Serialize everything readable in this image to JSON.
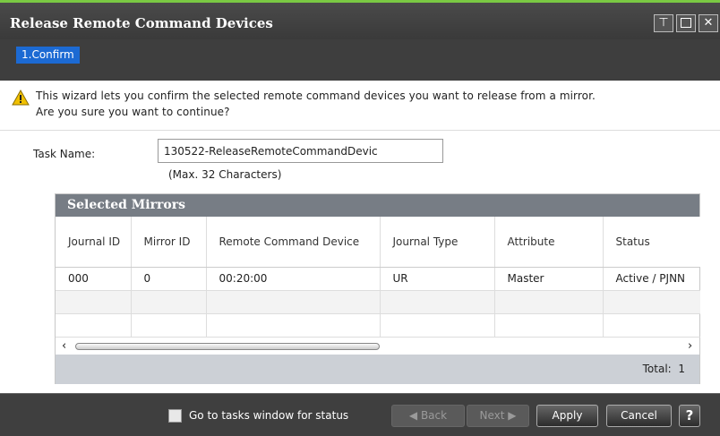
{
  "window": {
    "title": "Release Remote Command Devices",
    "pin_symbol": "⊤",
    "close_symbol": "✕"
  },
  "steps": [
    {
      "label": "1.Confirm"
    }
  ],
  "warning": {
    "line1": "This wizard lets you confirm the selected remote command devices you want to release from a mirror.",
    "line2": "Are you sure you want to continue?"
  },
  "task": {
    "label": "Task Name:",
    "value": "130522-ReleaseRemoteCommandDevic",
    "hint": "(Max. 32 Characters)"
  },
  "mirrors": {
    "title": "Selected Mirrors",
    "columns": [
      "Journal ID",
      "Mirror ID",
      "Remote Command Device",
      "Journal Type",
      "Attribute",
      "Status"
    ],
    "rows": [
      [
        "000",
        "0",
        "00:20:00",
        "UR",
        "Master",
        "Active / PJNN"
      ]
    ],
    "total_label": "Total:",
    "total": "1"
  },
  "footer": {
    "checkbox_label": "Go to tasks window for status",
    "checkbox_checked": false,
    "back_label": "◀ Back",
    "next_label": "Next ▶",
    "apply_label": "Apply",
    "cancel_label": "Cancel",
    "help_label": "?"
  },
  "colors": {
    "accent": "#1c6ad3",
    "titlebar": "#3a3a3a",
    "top_stripe": "#7ac943",
    "panel_head": "#777d85",
    "warning": "#f0c000"
  }
}
